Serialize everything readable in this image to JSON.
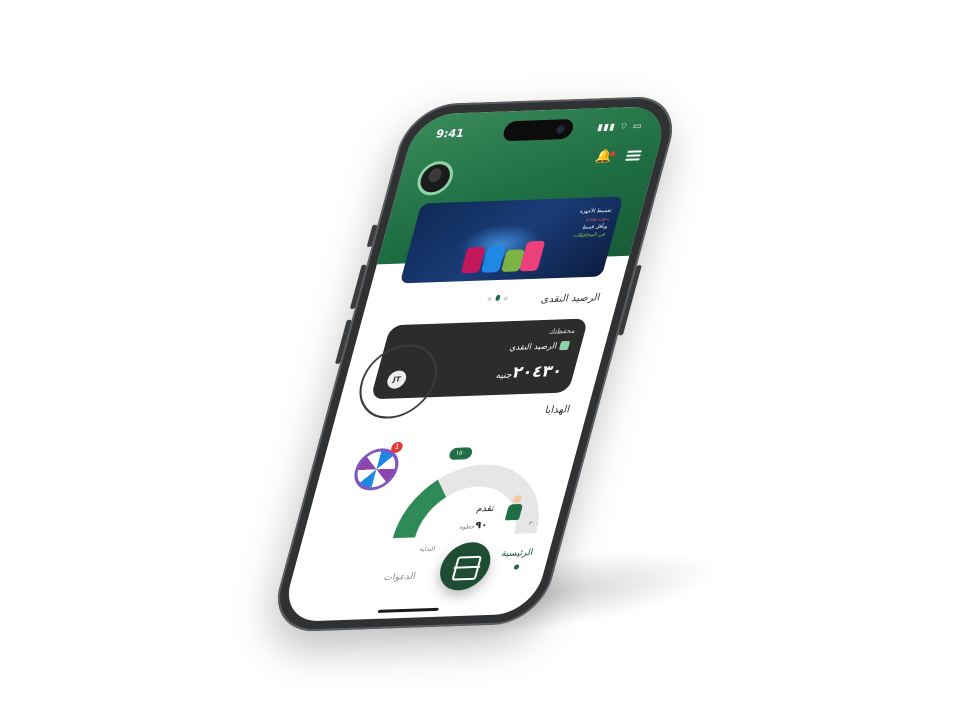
{
  "status": {
    "time": "9:41",
    "icons": "▮▮▮ ⌔ ▭"
  },
  "header": {
    "menu": "menu-icon",
    "bell": "bell-icon"
  },
  "banner": {
    "line1": "تقسيط الأجهزة",
    "line2": "بدون مقدم",
    "line3": "وبأقل قسط",
    "line4": "في المحافظات"
  },
  "cash_section": {
    "title": "الرصيد النقدى"
  },
  "wallet": {
    "title": "محفظتك",
    "balance_label": "الرصيد النقدي",
    "amount": "٢٠٤٣٠",
    "currency": "جنيه",
    "brand": "JT"
  },
  "gifts_section": {
    "title": "الهدايا"
  },
  "wheel": {
    "badge": "1"
  },
  "progress": {
    "target": "١٥٠",
    "label": "تقدم",
    "steps": "٩٠",
    "steps_unit": "خطوة",
    "start_label": "البداية",
    "end_label": "٣٠٠",
    "value": 90,
    "max": 300
  },
  "bottom_nav": {
    "home": "الرئيسية",
    "invites": "الدعوات"
  },
  "colors": {
    "primary": "#1f6e44",
    "dark": "#2c2c2c"
  }
}
